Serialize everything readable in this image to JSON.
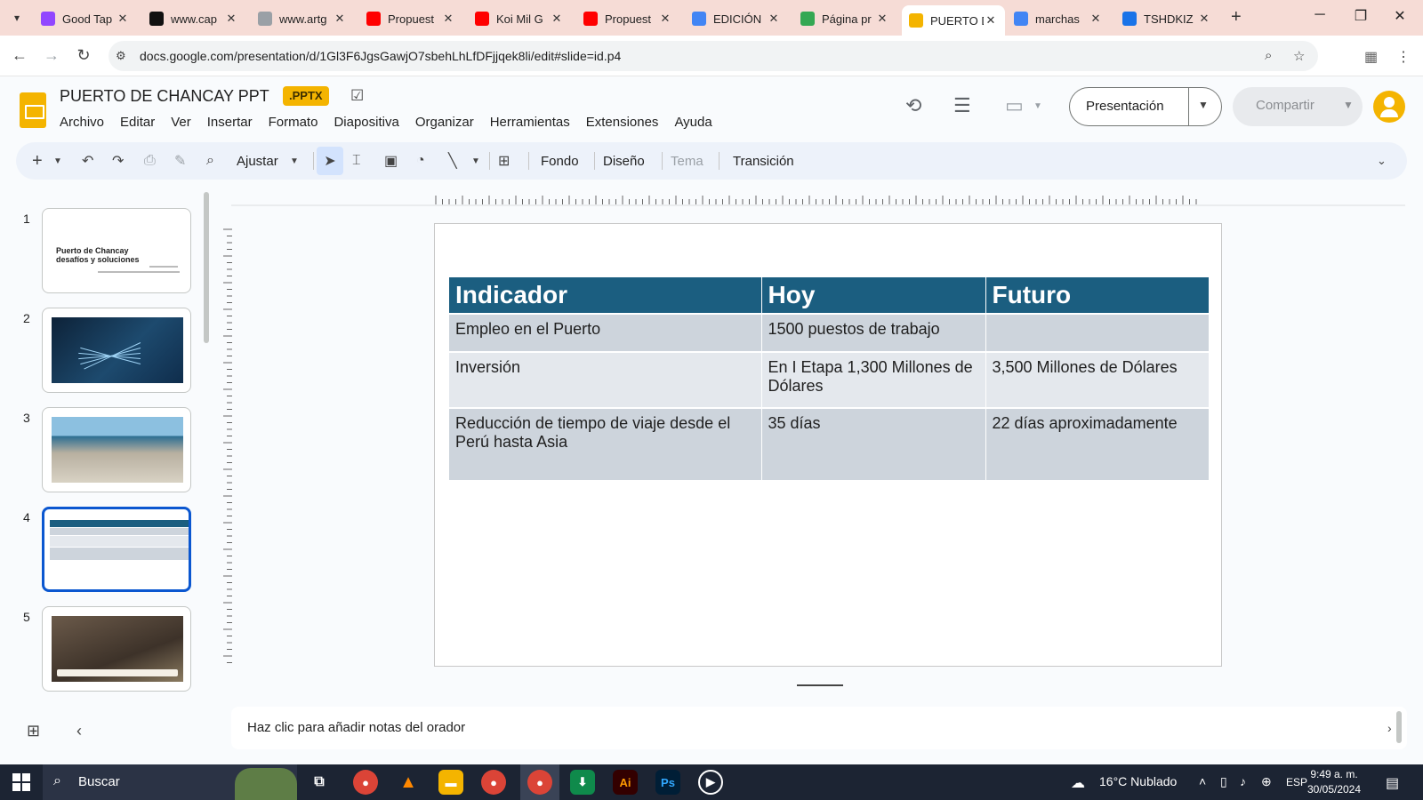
{
  "browser": {
    "tabs": [
      {
        "label": "Good Tap",
        "icon": "twitch-icon",
        "color": "#9146ff"
      },
      {
        "label": "www.cap",
        "icon": "capcut-icon",
        "color": "#111111"
      },
      {
        "label": "www.artg",
        "icon": "artguru-icon",
        "color": "#9aa0a6"
      },
      {
        "label": "Propuest",
        "icon": "youtube-icon",
        "color": "#ff0000"
      },
      {
        "label": "Koi Mil G",
        "icon": "youtube-icon",
        "color": "#ff0000"
      },
      {
        "label": "Propuest",
        "icon": "youtube-icon",
        "color": "#ff0000"
      },
      {
        "label": "EDICIÓN",
        "icon": "docs-icon",
        "color": "#4285f4"
      },
      {
        "label": "Página pr",
        "icon": "drive-icon",
        "color": "#34a853"
      },
      {
        "label": "PUERTO D",
        "icon": "slides-icon",
        "color": "#f4b400",
        "active": true
      },
      {
        "label": "marchas",
        "icon": "google-icon",
        "color": "#4285f4"
      },
      {
        "label": "TSHDKIZ",
        "icon": "p2-icon",
        "color": "#1a73e8"
      }
    ],
    "url": "docs.google.com/presentation/d/1Gl3F6JgsGawjO7sbehLhLfDFjjqek8li/edit#slide=id.p4"
  },
  "doc": {
    "title": "PUERTO DE CHANCAY PPT",
    "badge": ".PPTX",
    "menu": [
      "Archivo",
      "Editar",
      "Ver",
      "Insertar",
      "Formato",
      "Diapositiva",
      "Organizar",
      "Herramientas",
      "Extensiones",
      "Ayuda"
    ],
    "present_label": "Presentación",
    "share_label": "Compartir"
  },
  "toolbar": {
    "zoom_label": "Ajustar",
    "background": "Fondo",
    "layout": "Diseño",
    "theme": "Tema",
    "transition": "Transición"
  },
  "slides": [
    {
      "number": "1",
      "title_line1": "Puerto de Chancay",
      "title_line2": "desafíos y soluciones"
    },
    {
      "number": "2"
    },
    {
      "number": "3"
    },
    {
      "number": "4"
    },
    {
      "number": "5"
    }
  ],
  "table": {
    "headers": [
      "Indicador",
      "Hoy",
      "Futuro"
    ],
    "rows": [
      [
        "Empleo en el Puerto",
        "1500 puestos de trabajo",
        ""
      ],
      [
        "Inversión",
        "En I Etapa 1,300 Millones de Dólares",
        "3,500 Millones de Dólares"
      ],
      [
        "Reducción de tiempo de viaje desde el Perú hasta Asia",
        "35 días",
        "22 días aproximadamente"
      ]
    ],
    "header_color": "#1b5e80"
  },
  "notes": {
    "placeholder": "Haz clic para añadir notas del orador"
  },
  "taskbar": {
    "search_label": "Buscar",
    "weather": "16°C  Nublado",
    "language": "ESP",
    "time": "9:49 a. m.",
    "date": "30/05/2024"
  }
}
